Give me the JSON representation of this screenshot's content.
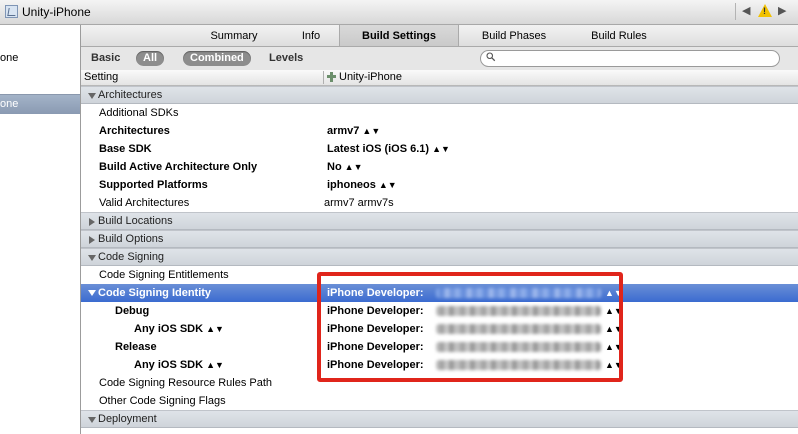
{
  "window": {
    "project_title": "Unity-iPhone",
    "nav_arrows": "◀ ▶",
    "warning_symbol": "!"
  },
  "navigator": {
    "items": [
      {
        "label": "one"
      },
      {
        "label": "one",
        "selected": true
      }
    ]
  },
  "tabs": [
    {
      "label": "Summary"
    },
    {
      "label": "Info"
    },
    {
      "label": "Build Settings",
      "active": true
    },
    {
      "label": "Build Phases"
    },
    {
      "label": "Build Rules"
    }
  ],
  "filters": {
    "basic": "Basic",
    "all": "All",
    "combined": "Combined",
    "levels": "Levels",
    "search_placeholder": ""
  },
  "header": {
    "setting": "Setting",
    "target": "Unity-iPhone"
  },
  "sections": {
    "architectures": "Architectures",
    "build_locations": "Build Locations",
    "build_options": "Build Options",
    "code_signing": "Code Signing",
    "deployment": "Deployment"
  },
  "settings": {
    "additional_sdks": {
      "name": "Additional SDKs",
      "value": ""
    },
    "architectures": {
      "name": "Architectures",
      "value": "armv7"
    },
    "base_sdk": {
      "name": "Base SDK",
      "value": "Latest iOS (iOS 6.1)"
    },
    "build_active_arch": {
      "name": "Build Active Architecture Only",
      "value": "No"
    },
    "supported_platforms": {
      "name": "Supported Platforms",
      "value": "iphoneos"
    },
    "valid_architectures": {
      "name": "Valid Architectures",
      "value": "armv7 armv7s"
    },
    "code_signing_entitlements": {
      "name": "Code Signing Entitlements",
      "value": ""
    },
    "code_signing_identity": {
      "name": "Code Signing Identity",
      "value": "iPhone Developer:"
    },
    "debug": {
      "name": "Debug",
      "value": "iPhone Developer:"
    },
    "debug_any_sdk": {
      "name": "Any iOS SDK",
      "value": "iPhone Developer:"
    },
    "release": {
      "name": "Release",
      "value": "iPhone Developer:"
    },
    "release_any_sdk": {
      "name": "Any iOS SDK",
      "value": "iPhone Developer:"
    },
    "resource_rules": {
      "name": "Code Signing Resource Rules Path",
      "value": ""
    },
    "other_flags": {
      "name": "Other Code Signing Flags",
      "value": ""
    }
  },
  "colors": {
    "selection": "#3b6bd0",
    "highlight_box": "#e0251b"
  }
}
